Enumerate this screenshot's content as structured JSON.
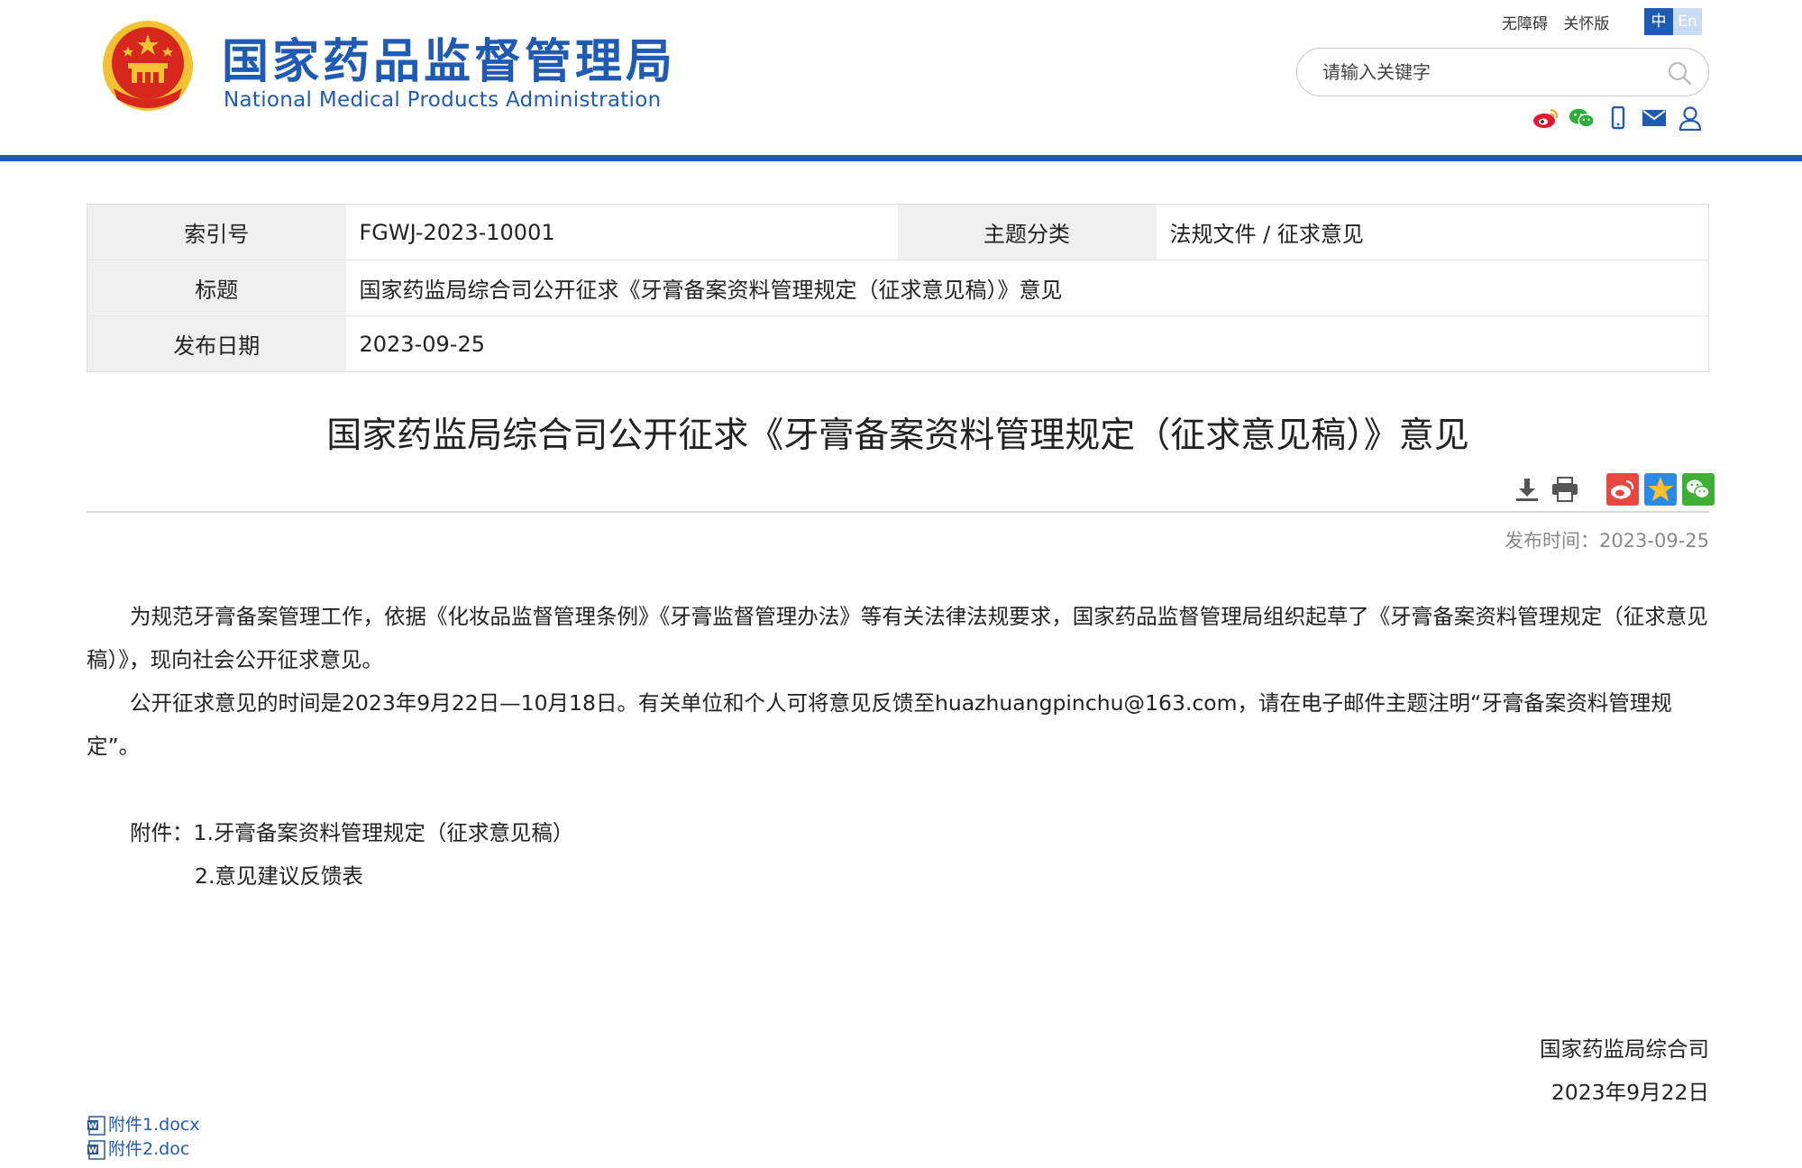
{
  "header": {
    "org_name_cn": "国家药品监督管理局",
    "org_name_en": "National Medical Products Administration",
    "links": [
      "无障碍",
      "关怀版"
    ],
    "lang": {
      "zh": "中",
      "en": "En"
    },
    "search_placeholder": "请输入关键字",
    "social_icons": [
      "weibo-icon",
      "wechat-icon",
      "mobile-icon",
      "mail-icon",
      "user-icon"
    ]
  },
  "info": {
    "index_label": "索引号",
    "index_value": "FGWJ-2023-10001",
    "category_label": "主题分类",
    "category_value": "法规文件 / 征求意见",
    "title_label": "标题",
    "title_value": "国家药监局综合司公开征求《牙膏备案资料管理规定（征求意见稿）》意见",
    "date_label": "发布日期",
    "date_value": "2023-09-25"
  },
  "article": {
    "title": "国家药监局综合司公开征求《牙膏备案资料管理规定（征求意见稿）》意见",
    "pub_time": "发布时间：2023-09-25",
    "paragraphs": [
      "为规范牙膏备案管理工作，依据《化妆品监督管理条例》《牙膏监督管理办法》等有关法律法规要求，国家药品监督管理局组织起草了《牙膏备案资料管理规定（征求意见稿）》，现向社会公开征求意见。",
      "公开征求意见的时间是2023年9月22日—10月18日。有关单位和个人可将意见反馈至huazhuangpinchu@163.com，请在电子邮件主题注明“牙膏备案资料管理规定”。"
    ],
    "attachments_label": "附件：",
    "attachment_1": "1.牙膏备案资料管理规定（征求意见稿）",
    "attachment_2": "2.意见建议反馈表",
    "signature_org": "国家药监局综合司",
    "signature_date": "2023年9月22日"
  },
  "files": {
    "file_1": "附件1.docx",
    "file_2": "附件2.doc"
  },
  "colors": {
    "brand_blue": "#1f5ab4",
    "emblem_red": "#d7261e",
    "emblem_gold": "#f2c233"
  }
}
